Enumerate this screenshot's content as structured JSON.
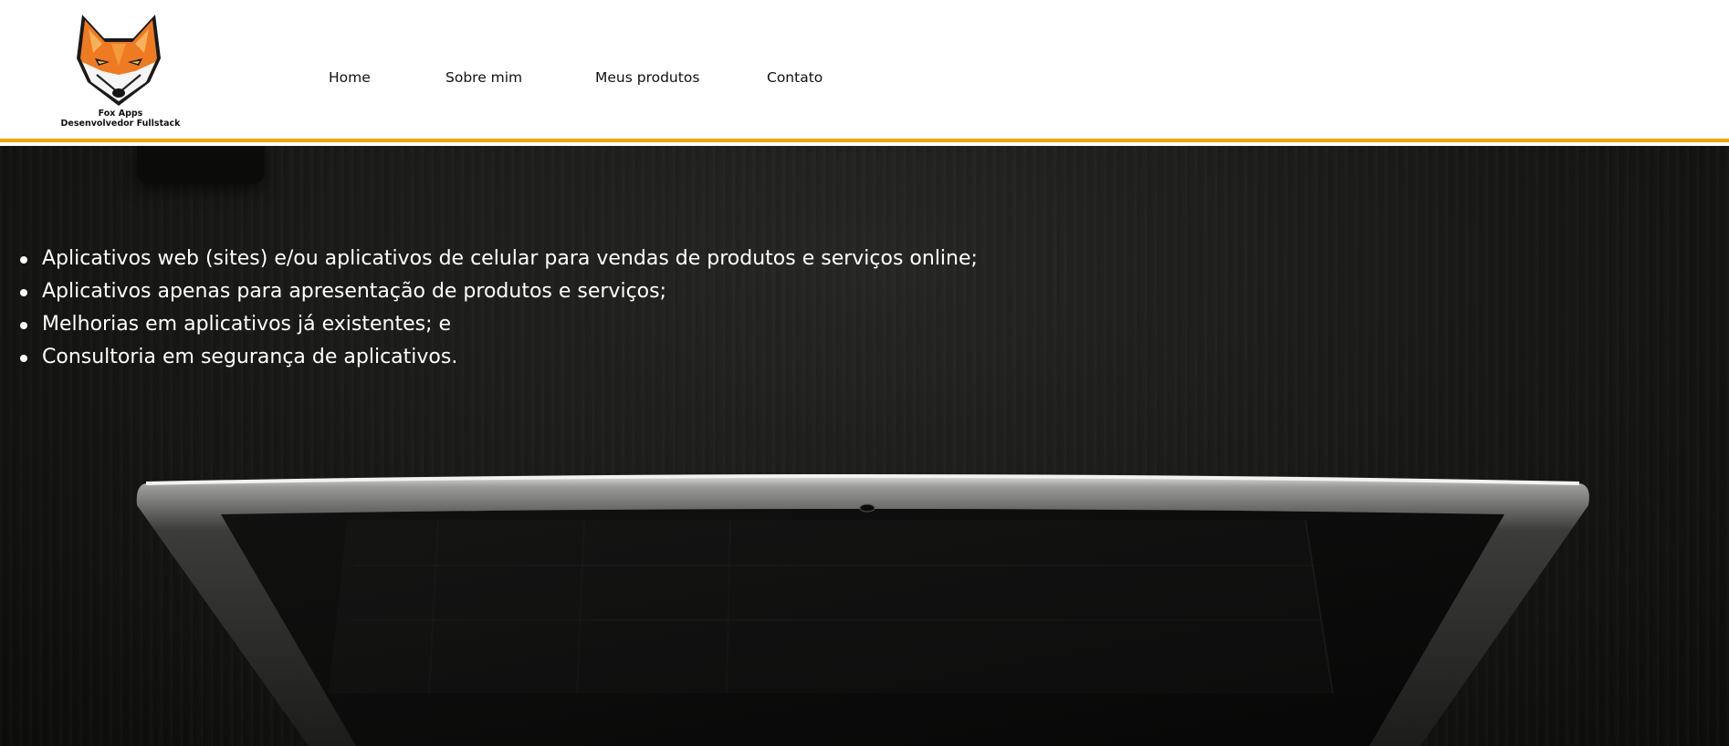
{
  "header": {
    "logo": {
      "icon": "fox-head-icon",
      "brand_name": "Fox Apps",
      "brand_tagline": "Desenvolvedor Fullstack"
    },
    "nav": [
      {
        "label": "Home"
      },
      {
        "label": "Sobre mim"
      },
      {
        "label": "Meus produtos"
      },
      {
        "label": "Contato"
      }
    ],
    "accent_color": "#f0a500"
  },
  "hero": {
    "background": "dark-desk-with-laptop",
    "services": [
      "Aplicativos web (sites) e/ou aplicativos de celular para vendas de produtos e serviços online;",
      "Aplicativos apenas para apresentação de produtos e serviços;",
      "Melhorias em aplicativos já existentes; e",
      "Consultoria em segurança de aplicativos."
    ],
    "text_color": "#ffffff"
  }
}
